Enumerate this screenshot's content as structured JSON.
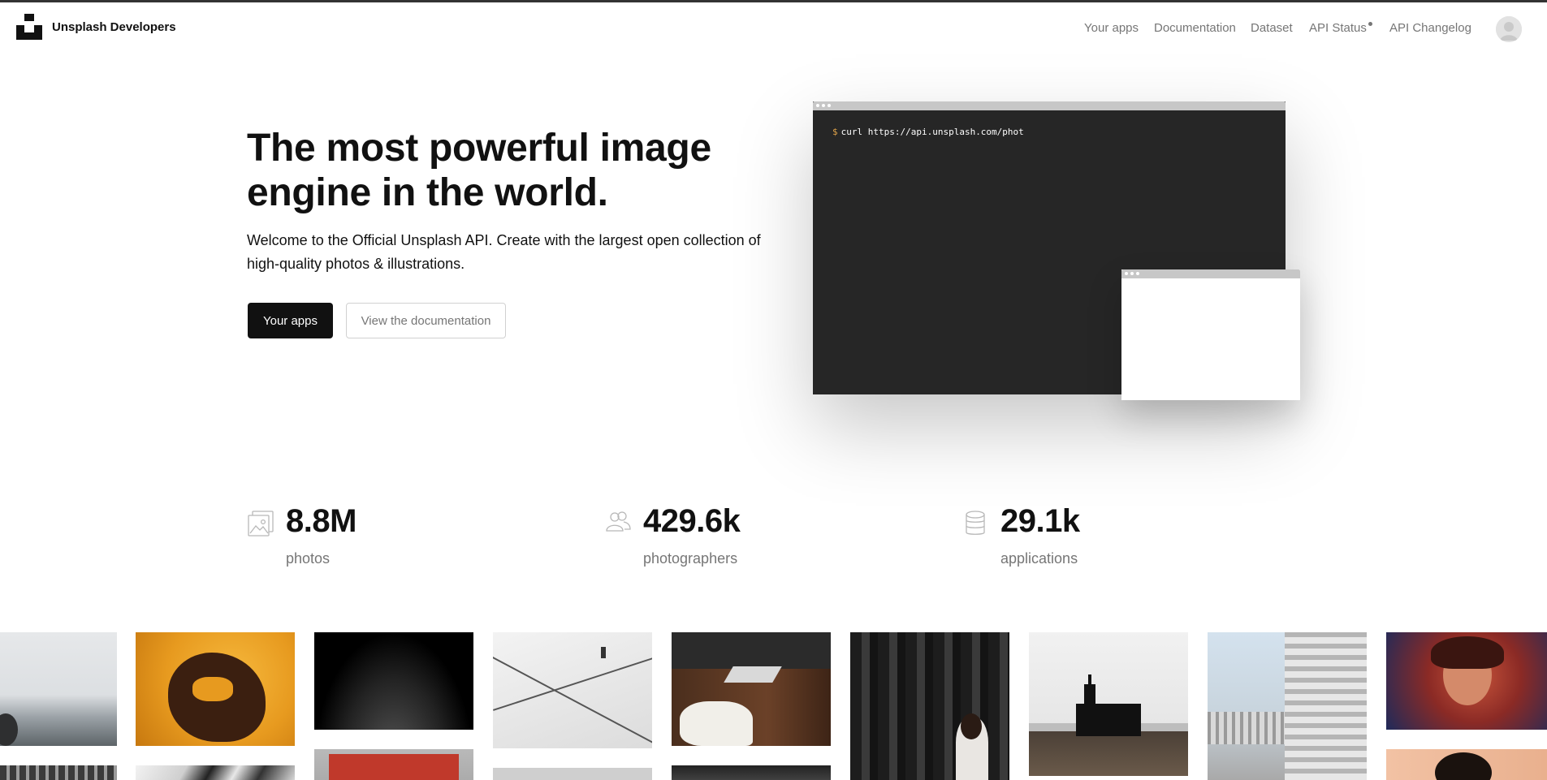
{
  "header": {
    "brand": "Unsplash Developers",
    "nav": [
      {
        "label": "Your apps"
      },
      {
        "label": "Documentation"
      },
      {
        "label": "Dataset"
      },
      {
        "label": "API Status"
      },
      {
        "label": "API Changelog"
      }
    ]
  },
  "hero": {
    "title": "The most powerful image engine in the world.",
    "subtitle": "Welcome to the Official Unsplash API. Create with the largest open collection of high-quality photos & illustrations.",
    "primary_button": "Your apps",
    "secondary_button": "View the documentation"
  },
  "terminal": {
    "prompt": "$",
    "command": "curl https://api.unsplash.com/phot"
  },
  "stats": [
    {
      "icon": "photos-icon",
      "value": "8.8M",
      "label": "photos"
    },
    {
      "icon": "photographers-icon",
      "value": "429.6k",
      "label": "photographers"
    },
    {
      "icon": "applications-icon",
      "value": "29.1k",
      "label": "applications"
    }
  ],
  "colors": {
    "text": "#111111",
    "muted": "#767676",
    "terminal_bg": "#262626",
    "accent_prompt": "#e0a34a"
  }
}
